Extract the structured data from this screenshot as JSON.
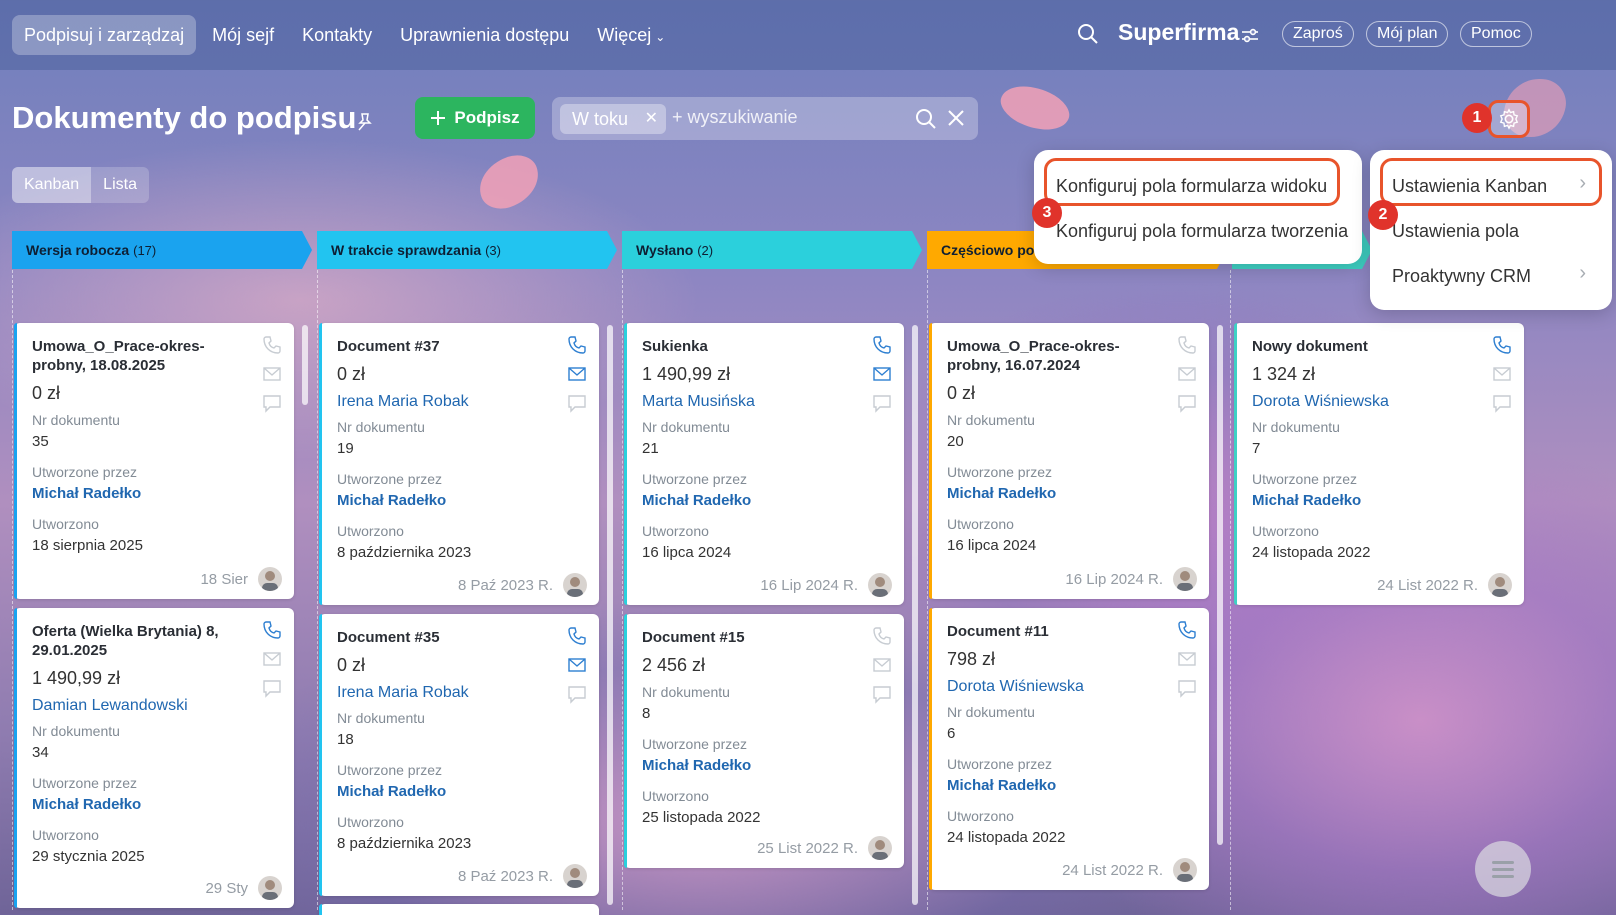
{
  "nav": {
    "items": [
      {
        "label": "Podpisuj i zarządzaj",
        "active": true
      },
      {
        "label": "Mój sejf"
      },
      {
        "label": "Kontakty"
      },
      {
        "label": "Uprawnienia dostępu"
      },
      {
        "label": "Więcej"
      }
    ],
    "brand": "Superfirma",
    "invite": "Zaproś",
    "plan": "Mój plan",
    "help": "Pomoc"
  },
  "page": {
    "title": "Dokumenty do podpisu",
    "sign_button": "Podpisz",
    "filter_chip": "W toku",
    "search_placeholder": "+ wyszukiwanie",
    "view_kanban": "Kanban",
    "view_list": "Lista"
  },
  "stages": [
    {
      "name": "Wersja robocza",
      "count": "(17)",
      "color": "#1aa3ef"
    },
    {
      "name": "W trakcie sprawdzania",
      "count": "(3)",
      "color": "#22c4f0"
    },
    {
      "name": "Wysłano",
      "count": "(2)",
      "color": "#2bd0dc"
    },
    {
      "name": "Częściowo po",
      "count": "",
      "color": "#ffa900"
    },
    {
      "name": "",
      "count": "",
      "color": "#3fd1c4"
    }
  ],
  "labels": {
    "doc_number": "Nr dokumentu",
    "created_by": "Utworzone przez",
    "created": "Utworzono"
  },
  "cards": [
    {
      "title": "Umowa_O_Prace-okres-probny, 18.08.2025",
      "amount": "0 zł",
      "number": "35",
      "author": "Michał Radełko",
      "date": "18 sierpnia 2025",
      "foot": "18 Sier"
    },
    {
      "title": "Oferta (Wielka Brytania) 8, 29.01.2025",
      "amount": "1 490,99 zł",
      "client": "Damian Lewandowski",
      "number": "34",
      "author": "Michał Radełko",
      "date": "29 stycznia 2025",
      "foot": "29 Sty"
    },
    {
      "title": "Document #37",
      "amount": "0 zł",
      "client": "Irena Maria Robak",
      "number": "19",
      "author": "Michał Radełko",
      "date": "8 października 2023",
      "foot": "8 Paź 2023 R."
    },
    {
      "title": "Document #35",
      "amount": "0 zł",
      "client": "Irena Maria Robak",
      "number": "18",
      "author": "Michał Radełko",
      "date": "8 października 2023",
      "foot": "8 Paź 2023 R."
    },
    {
      "title": "Sukienka",
      "amount": "1 490,99 zł",
      "client": "Marta Musińska",
      "number": "21",
      "author": "Michał Radełko",
      "date": "16 lipca 2024",
      "foot": "16 Lip 2024 R."
    },
    {
      "title": "Document #15",
      "amount": "2 456 zł",
      "number": "8",
      "author": "Michał Radełko",
      "date": "25 listopada 2022",
      "foot": "25 List 2022 R."
    },
    {
      "title": "Umowa_O_Prace-okres-probny, 16.07.2024",
      "amount": "0 zł",
      "number": "20",
      "author": "Michał Radełko",
      "date": "16 lipca 2024",
      "foot": "16 Lip 2024 R."
    },
    {
      "title": "Document #11",
      "amount": "798 zł",
      "client": "Dorota Wiśniewska",
      "number": "6",
      "author": "Michał Radełko",
      "date": "24 listopada 2022",
      "foot": "24 List 2022 R."
    },
    {
      "title": "Nowy dokument",
      "amount": "1 324 zł",
      "client": "Dorota Wiśniewska",
      "number": "7",
      "author": "Michał Radełko",
      "date": "24 listopada 2022",
      "foot": "24 List 2022 R."
    }
  ],
  "menus": {
    "form_fields": [
      "Konfiguruj pola formularza widoku",
      "Konfiguruj pola formularza tworzenia"
    ],
    "settings": [
      "Ustawienia Kanban",
      "Ustawienia pola",
      "Proaktywny CRM"
    ]
  },
  "markers": [
    "1",
    "2",
    "3"
  ],
  "colors": {
    "accent_green": "#2cb55f",
    "highlight": "#e8542b",
    "marker": "#e0332b",
    "link": "#2067b0"
  }
}
